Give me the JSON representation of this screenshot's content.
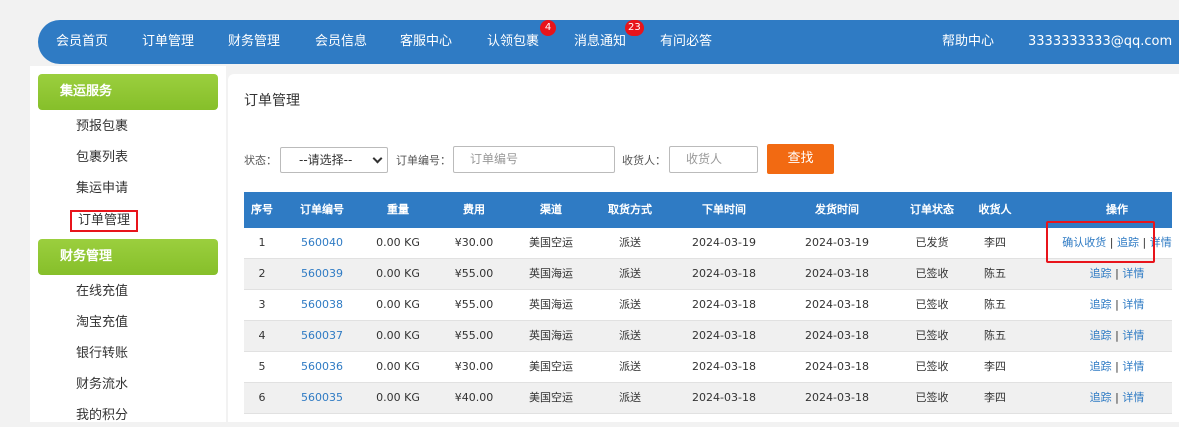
{
  "nav": {
    "items": [
      {
        "label": "会员首页"
      },
      {
        "label": "订单管理"
      },
      {
        "label": "财务管理"
      },
      {
        "label": "会员信息"
      },
      {
        "label": "客服中心"
      },
      {
        "label": "认领包裹",
        "badge": "4"
      },
      {
        "label": "消息通知",
        "badge": "23"
      },
      {
        "label": "有问必答"
      }
    ],
    "help": "帮助中心",
    "user_email": "3333333333@qq.com"
  },
  "sidebar": {
    "groups": [
      {
        "title": "集运服务",
        "items": [
          "预报包裹",
          "包裹列表",
          "集运申请",
          "订单管理"
        ]
      },
      {
        "title": "财务管理",
        "items": [
          "在线充值",
          "淘宝充值",
          "银行转账",
          "财务流水",
          "我的积分"
        ]
      }
    ]
  },
  "page": {
    "title": "订单管理"
  },
  "filters": {
    "status_label": "状态：",
    "status_value": "--请选择--",
    "order_no_label": "订单编号：",
    "order_no_placeholder": "订单编号",
    "receiver_label": "收货人：",
    "receiver_placeholder": "收货人",
    "search_label": "查找"
  },
  "table": {
    "headers": [
      "序号",
      "订单编号",
      "重量",
      "费用",
      "渠道",
      "取货方式",
      "下单时间",
      "发货时间",
      "订单状态",
      "收货人",
      "操作"
    ],
    "rows": [
      {
        "idx": "1",
        "order_no": "560040",
        "weight": "0.00 KG",
        "fee": "¥30.00",
        "channel": "美国空运",
        "pickup": "派送",
        "order_time": "2024-03-19",
        "ship_time": "2024-03-19",
        "status": "已发货",
        "receiver": "李四",
        "ops": [
          "确认收货",
          "追踪",
          "详情"
        ]
      },
      {
        "idx": "2",
        "order_no": "560039",
        "weight": "0.00 KG",
        "fee": "¥55.00",
        "channel": "英国海运",
        "pickup": "派送",
        "order_time": "2024-03-18",
        "ship_time": "2024-03-18",
        "status": "已签收",
        "receiver": "陈五",
        "ops": [
          "追踪",
          "详情"
        ]
      },
      {
        "idx": "3",
        "order_no": "560038",
        "weight": "0.00 KG",
        "fee": "¥55.00",
        "channel": "英国海运",
        "pickup": "派送",
        "order_time": "2024-03-18",
        "ship_time": "2024-03-18",
        "status": "已签收",
        "receiver": "陈五",
        "ops": [
          "追踪",
          "详情"
        ]
      },
      {
        "idx": "4",
        "order_no": "560037",
        "weight": "0.00 KG",
        "fee": "¥55.00",
        "channel": "英国海运",
        "pickup": "派送",
        "order_time": "2024-03-18",
        "ship_time": "2024-03-18",
        "status": "已签收",
        "receiver": "陈五",
        "ops": [
          "追踪",
          "详情"
        ]
      },
      {
        "idx": "5",
        "order_no": "560036",
        "weight": "0.00 KG",
        "fee": "¥30.00",
        "channel": "美国空运",
        "pickup": "派送",
        "order_time": "2024-03-18",
        "ship_time": "2024-03-18",
        "status": "已签收",
        "receiver": "李四",
        "ops": [
          "追踪",
          "详情"
        ]
      },
      {
        "idx": "6",
        "order_no": "560035",
        "weight": "0.00 KG",
        "fee": "¥40.00",
        "channel": "美国空运",
        "pickup": "派送",
        "order_time": "2024-03-18",
        "ship_time": "2024-03-18",
        "status": "已签收",
        "receiver": "李四",
        "ops": [
          "追踪",
          "详情"
        ]
      }
    ]
  },
  "colors": {
    "nav_blue": "#2f7bc4",
    "sidebar_green": "#8cc63f",
    "search_orange": "#f26a12",
    "highlight_red": "#e8141b",
    "badge_red": "#e8141b"
  }
}
